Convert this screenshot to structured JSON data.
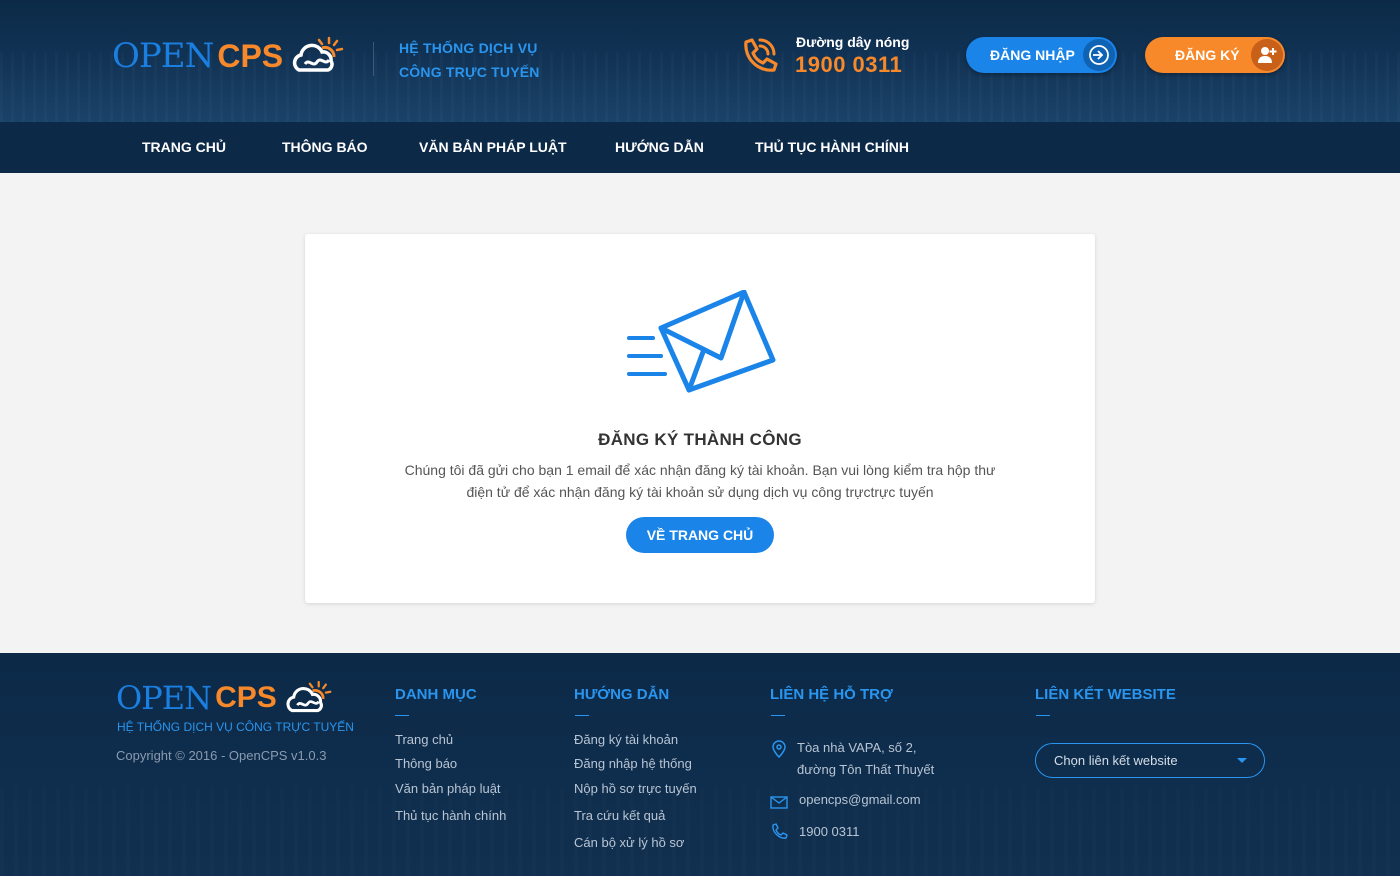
{
  "brand": {
    "logo_open": "OPEN",
    "logo_cps": "CPS",
    "tagline_line1": "HỆ THỐNG DỊCH VỤ",
    "tagline_line2": "CÔNG TRỰC TUYẾN",
    "primary_color": "#1a84e8",
    "accent_color": "#f7892a"
  },
  "header": {
    "hotline_label": "Đường dây nóng",
    "hotline_number": "1900 0311",
    "hotline_icon": "phone-icon",
    "login_label": "ĐĂNG NHẬP",
    "login_icon": "sign-in-icon",
    "register_label": "ĐĂNG KÝ",
    "register_icon": "add-user-icon"
  },
  "nav": {
    "items": [
      {
        "label": "TRANG CHỦ"
      },
      {
        "label": "THÔNG BÁO"
      },
      {
        "label": "VĂN BẢN PHÁP LUẬT"
      },
      {
        "label": "HƯỚNG DẪN"
      },
      {
        "label": "THỦ TỤC HÀNH CHÍNH"
      }
    ]
  },
  "main": {
    "icon": "envelope-sent-icon",
    "title": "ĐĂNG KÝ THÀNH CÔNG",
    "message_line1": "Chúng tôi đã gửi cho bạn 1 email để xác nhận đăng ký tài khoản. Bạn vui lòng kiểm tra hộp thư",
    "message_line2": "điện tử để xác nhận đăng ký tài khoản sử dụng dịch vụ công trựctrực tuyến",
    "home_button": "VỀ TRANG CHỦ"
  },
  "footer": {
    "tagline": "HỆ THỐNG DỊCH VỤ CÔNG TRỰC TUYẾN",
    "copyright": "Copyright © 2016 - OpenCPS v1.0.3",
    "categories": {
      "title": "DANH MỤC",
      "links": [
        "Trang chủ",
        "Thông báo",
        "Văn bản pháp luật",
        "Thủ tục hành chính"
      ]
    },
    "guide": {
      "title": "HƯỚNG DẪN",
      "links": [
        "Đăng ký tài khoản",
        "Đăng nhập hệ thống",
        "Nộp hồ sơ trực tuyến",
        "Tra cứu kết quả",
        "Cán bộ xử lý hồ sơ"
      ]
    },
    "support": {
      "title": "LIÊN HỆ HỖ TRỢ",
      "address_line1": "Tòa nhà VAPA, số 2,",
      "address_line2": "đường Tôn Thất Thuyết",
      "email": "opencps@gmail.com",
      "phone": "1900 0311"
    },
    "links": {
      "title": "LIÊN KẾT WEBSITE",
      "select_value": "Chọn liên kết website"
    }
  }
}
